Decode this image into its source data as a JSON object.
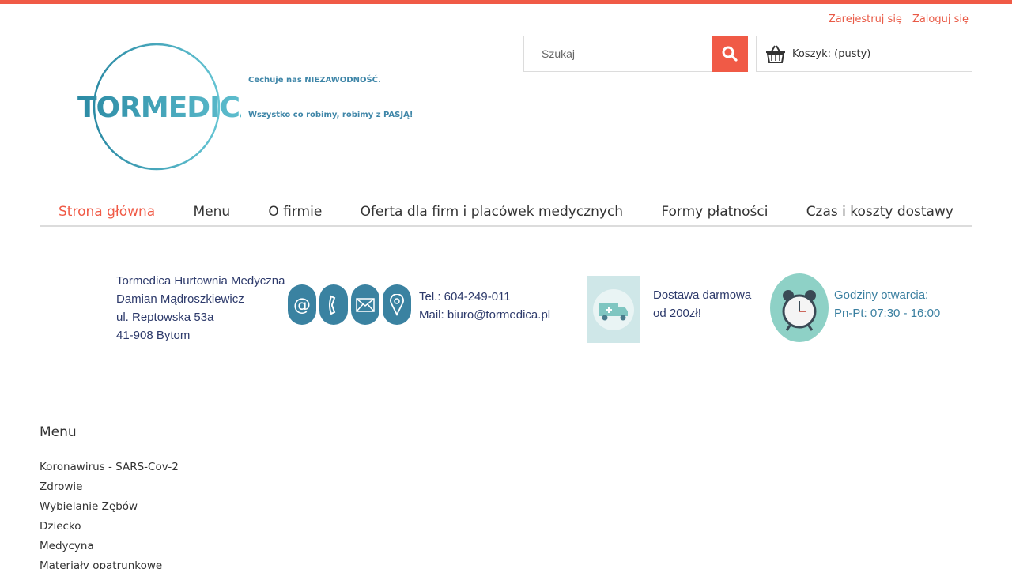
{
  "header": {
    "register_label": "Zarejestruj się",
    "login_label": "Zaloguj się",
    "search_placeholder": "Szukaj",
    "cart_label": "Koszyk: (pusty)"
  },
  "logo": {
    "text": "TORMEDICA",
    "slogan_1": "Cechuje nas NIEZAWODNOŚĆ.",
    "slogan_2": "Wszystko co robimy, robimy z PASJĄ!"
  },
  "nav": {
    "items": [
      {
        "label": "Strona główna",
        "active": true
      },
      {
        "label": "Menu"
      },
      {
        "label": "O firmie"
      },
      {
        "label": "Oferta dla firm i placówek medycznych"
      },
      {
        "label": "Formy płatności"
      },
      {
        "label": "Czas i koszty dostawy"
      }
    ]
  },
  "banner": {
    "address": [
      "Tormedica Hurtownia Medyczna",
      "Damian Mądroszkiewicz",
      "ul. Reptowska 53a",
      "41-908 Bytom"
    ],
    "tel": "Tel.: 604-249-011",
    "mail": "Mail: biuro@tormedica.pl",
    "delivery": [
      "Dostawa darmowa",
      "od 200zł!"
    ],
    "hours": [
      "Godziny otwarcia:",
      "Pn-Pt: 07:30 - 16:00"
    ]
  },
  "sidebar": {
    "title": "Menu",
    "items": [
      "Koronawirus - SARS-Cov-2",
      "Zdrowie",
      "Wybielanie Zębów",
      "Dziecko",
      "Medycyna",
      "Materiały opatrunkowe"
    ]
  },
  "colors": {
    "accent": "#f05a46",
    "brand_teal": "#3a82a1",
    "brand_light": "#5bc0d0"
  }
}
